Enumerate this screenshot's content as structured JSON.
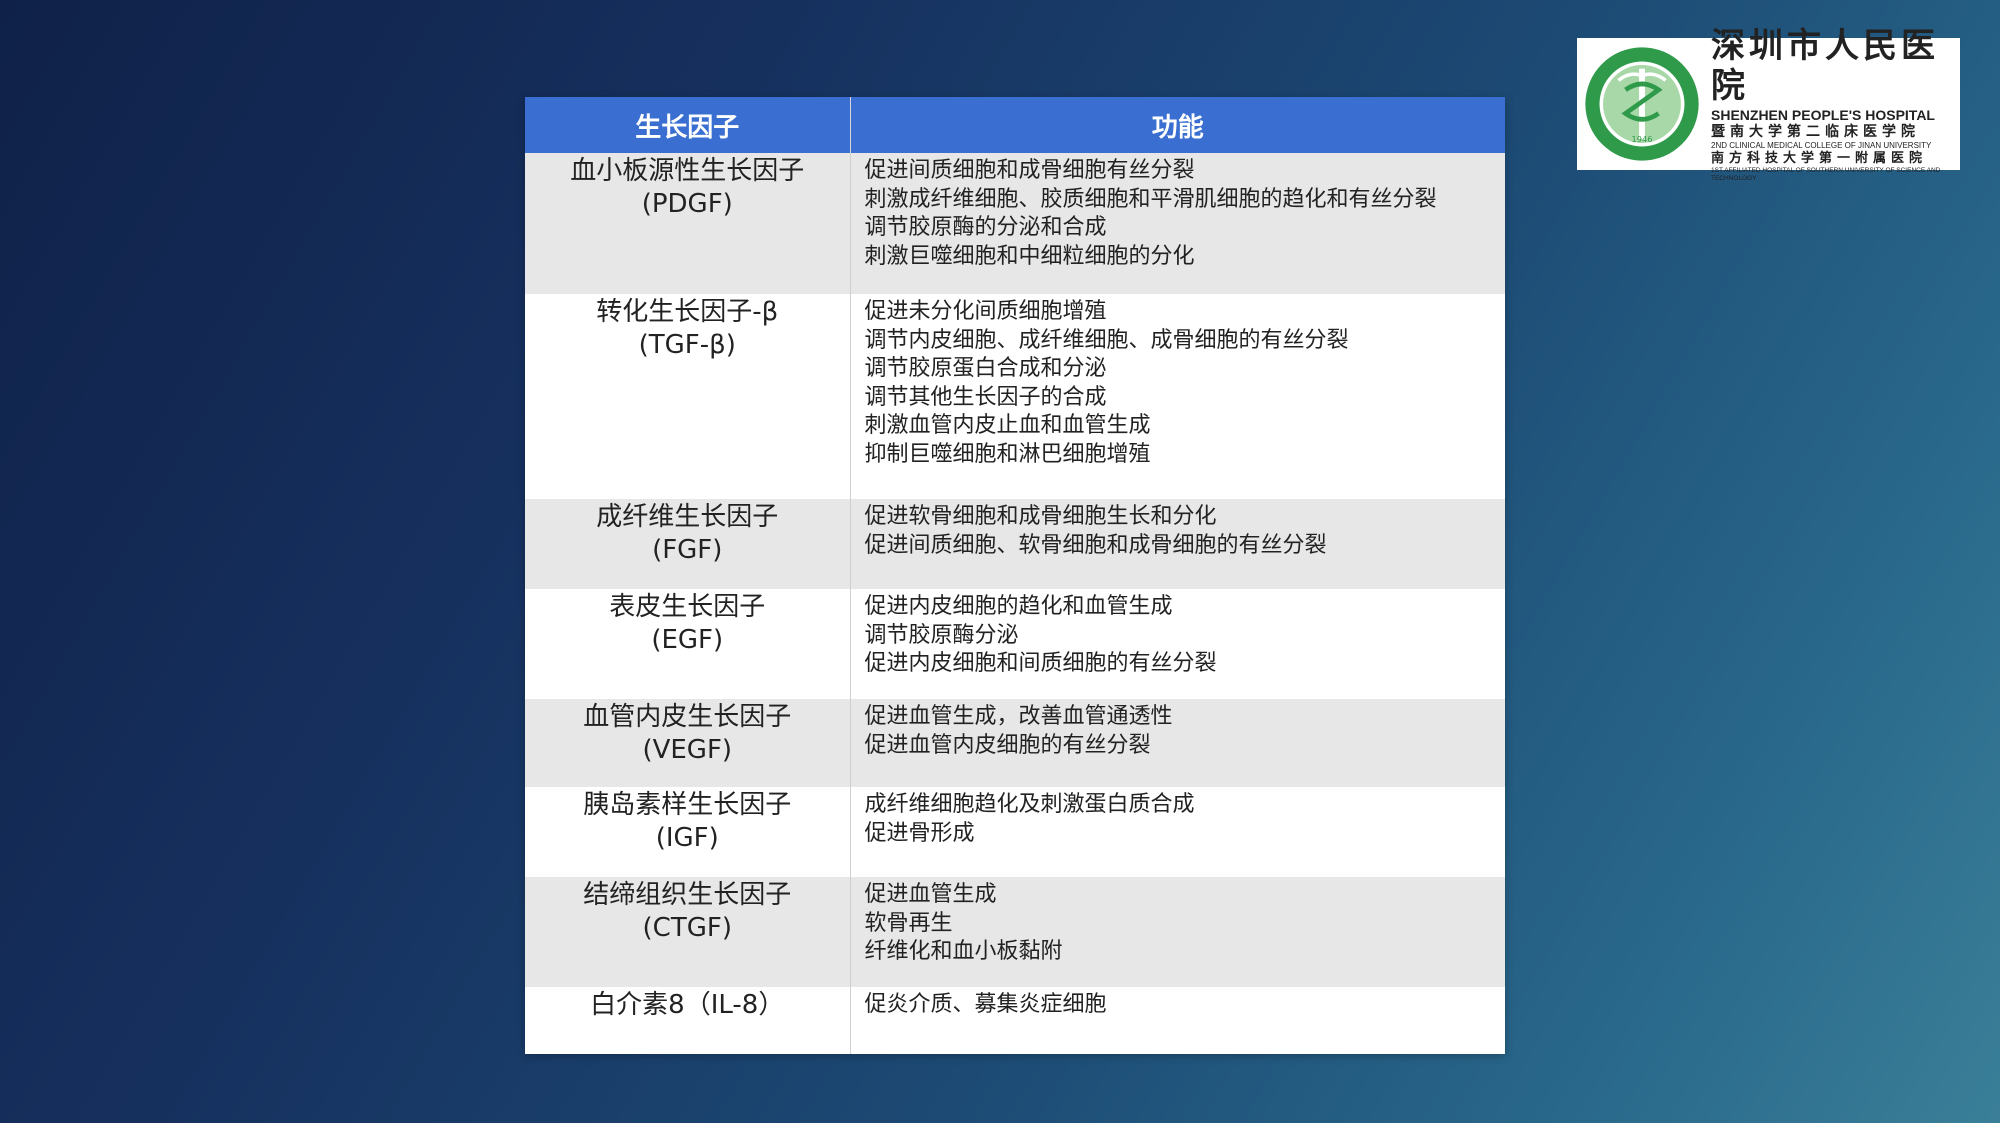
{
  "table": {
    "headers": [
      "生长因子",
      "功能"
    ],
    "rows": [
      {
        "name": "血小板源性生长因子",
        "abbr": "(PDGF)",
        "functions": [
          "促进间质细胞和成骨细胞有丝分裂",
          "刺激成纤维细胞、胶质细胞和平滑肌细胞的趋化和有丝分裂",
          "调节胶原酶的分泌和合成",
          "刺激巨噬细胞和中细粒细胞的分化"
        ]
      },
      {
        "name": "转化生长因子-β",
        "abbr": "(TGF-β)",
        "functions": [
          "促进未分化间质细胞增殖",
          "调节内皮细胞、成纤维细胞、成骨细胞的有丝分裂",
          "调节胶原蛋白合成和分泌",
          "调节其他生长因子的合成",
          "刺激血管内皮止血和血管生成",
          "抑制巨噬细胞和淋巴细胞增殖"
        ]
      },
      {
        "name": "成纤维生长因子",
        "abbr": "(FGF)",
        "functions": [
          "促进软骨细胞和成骨细胞生长和分化",
          "促进间质细胞、软骨细胞和成骨细胞的有丝分裂"
        ]
      },
      {
        "name": "表皮生长因子",
        "abbr": "(EGF)",
        "functions": [
          "促进内皮细胞的趋化和血管生成",
          "调节胶原酶分泌",
          "促进内皮细胞和间质细胞的有丝分裂"
        ]
      },
      {
        "name": "血管内皮生长因子",
        "abbr": "(VEGF)",
        "functions": [
          "促进血管生成，改善血管通透性",
          "促进血管内皮细胞的有丝分裂"
        ]
      },
      {
        "name": "胰岛素样生长因子",
        "abbr": "(IGF)",
        "functions": [
          "成纤维细胞趋化及刺激蛋白质合成",
          "促进骨形成"
        ]
      },
      {
        "name": "结缔组织生长因子",
        "abbr": "(CTGF)",
        "functions": [
          "促进血管生成",
          "软骨再生",
          "纤维化和血小板黏附"
        ]
      },
      {
        "name": "白介素8（IL-8）",
        "abbr": "",
        "functions": [
          "促炎介质、募集炎症细胞"
        ]
      }
    ]
  },
  "logo": {
    "name_cn": "深圳市人民医院",
    "name_en": "SHENZHEN PEOPLE'S HOSPITAL",
    "line3": "暨南大学第二临床医学院",
    "line4": "2ND CLINICAL MEDICAL COLLEGE OF JINAN UNIVERSITY",
    "line5": "南方科技大学第一附属医院",
    "line6": "1ST AFFILIATED HOSPITAL OF SOUTHERN UNIVERSITY OF SCIENCE AND TECHNOLOGY",
    "emblem_year": "1946",
    "colors": {
      "emblem_green": "#2e9a4a",
      "emblem_light": "#a8d8a8"
    }
  },
  "colors": {
    "header_blue": "#3a6fd1",
    "row_gray": "#e7e7e7"
  }
}
